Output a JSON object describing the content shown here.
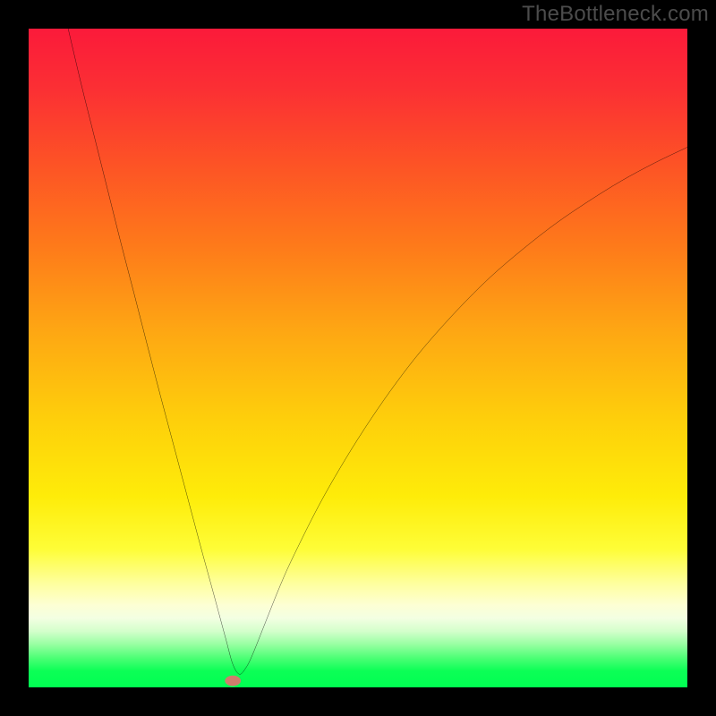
{
  "watermark": "TheBottleneck.com",
  "chart_data": {
    "type": "line",
    "title": "",
    "xlabel": "",
    "ylabel": "",
    "xlim": [
      0,
      100
    ],
    "ylim": [
      0,
      100
    ],
    "grid": false,
    "legend": false,
    "marker": {
      "x": 31,
      "y": 1,
      "color": "#cf7d6d",
      "rx": 1.2,
      "ry": 0.8
    },
    "series": [
      {
        "name": "curve",
        "color": "#000000",
        "x": [
          6,
          8,
          10,
          12,
          14,
          16,
          18,
          20,
          22,
          24,
          26,
          28,
          29,
          30,
          31,
          32,
          33,
          34,
          36,
          38,
          40,
          44,
          48,
          52,
          56,
          60,
          65,
          70,
          75,
          80,
          85,
          90,
          95,
          100
        ],
        "y": [
          100,
          91.5,
          83.5,
          75.5,
          67.5,
          59.8,
          52.0,
          44.3,
          36.8,
          29.3,
          21.8,
          14.5,
          10.8,
          7.1,
          3.5,
          2.0,
          3.0,
          5.0,
          10.0,
          15.0,
          19.5,
          27.5,
          34.5,
          40.8,
          46.5,
          51.6,
          57.2,
          62.2,
          66.5,
          70.4,
          73.8,
          76.9,
          79.6,
          82.0
        ]
      }
    ],
    "background_gradient_stops": [
      {
        "pct": 0,
        "color": "#fb1a3a"
      },
      {
        "pct": 9,
        "color": "#fb2f34"
      },
      {
        "pct": 20,
        "color": "#fd5126"
      },
      {
        "pct": 33,
        "color": "#fe7a1a"
      },
      {
        "pct": 46,
        "color": "#fea713"
      },
      {
        "pct": 59,
        "color": "#fece0b"
      },
      {
        "pct": 71,
        "color": "#feec09"
      },
      {
        "pct": 79,
        "color": "#fefd37"
      },
      {
        "pct": 84,
        "color": "#feff9a"
      },
      {
        "pct": 87.5,
        "color": "#fdffd4"
      },
      {
        "pct": 89.5,
        "color": "#f3ffe2"
      },
      {
        "pct": 91.5,
        "color": "#d3ffcb"
      },
      {
        "pct": 93.5,
        "color": "#97ffa1"
      },
      {
        "pct": 95.5,
        "color": "#4eff76"
      },
      {
        "pct": 97.5,
        "color": "#0cff56"
      },
      {
        "pct": 100,
        "color": "#00ff52"
      }
    ]
  }
}
